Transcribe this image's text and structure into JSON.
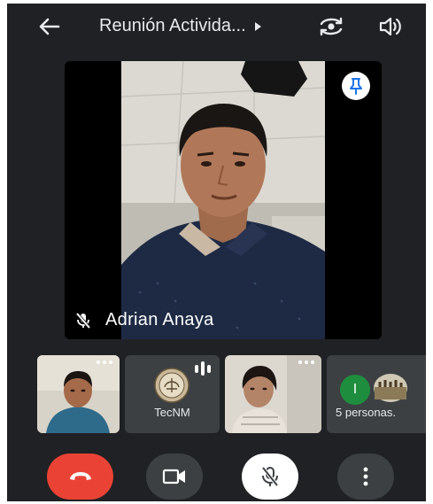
{
  "header": {
    "title": "Reunión Activida...",
    "icons": {
      "back": "arrow-back-icon",
      "switch_camera": "switch-camera-icon",
      "speaker": "speaker-icon"
    }
  },
  "main_video": {
    "participant_name": "Adrian Anaya",
    "muted": true,
    "pinned": true
  },
  "thumbnails": [
    {
      "type": "video",
      "more": "⋯"
    },
    {
      "type": "avatar",
      "label": "TecNM",
      "speaking": true
    },
    {
      "type": "video",
      "more": "⋯"
    },
    {
      "type": "overflow",
      "label": "5 personas.",
      "avatar_initial": "I"
    }
  ],
  "controls": {
    "end_call": "end-call-icon",
    "camera": "camera-icon",
    "mic": "mic-off-icon",
    "more": "more-vert-icon"
  },
  "colors": {
    "background": "#202124",
    "end_call": "#ea4335",
    "control_dark": "#3c4043",
    "avatar_green": "#1e8e3e"
  }
}
